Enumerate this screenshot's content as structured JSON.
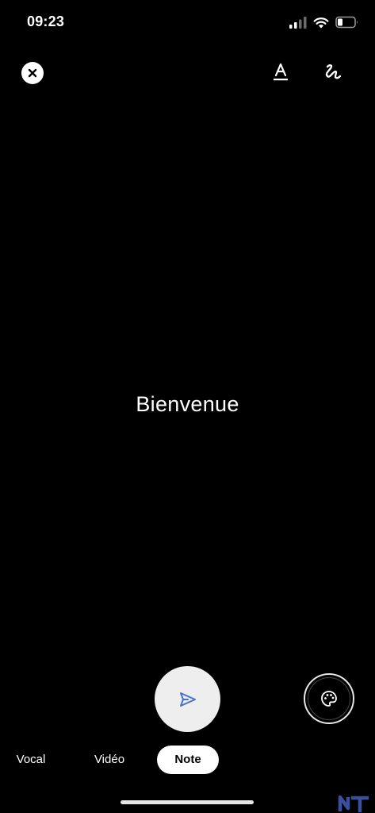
{
  "status_bar": {
    "time": "09:23",
    "icons": [
      "signal-icon",
      "wifi-icon",
      "battery-icon"
    ]
  },
  "toolbar": {
    "close_icon": "close-icon",
    "text_style_icon": "text-style-icon",
    "draw_icon": "squiggle-draw-icon"
  },
  "note": {
    "text": "Bienvenue"
  },
  "actions": {
    "send_icon": "send-icon",
    "palette_icon": "palette-icon"
  },
  "mode_tabs": [
    {
      "label": "Vocal",
      "selected": false
    },
    {
      "label": "Vidéo",
      "selected": false
    },
    {
      "label": "Note",
      "selected": true
    }
  ],
  "colors": {
    "background": "#000000",
    "foreground": "#ffffff",
    "send_icon": "#4a6fd6",
    "send_button_bg": "#eeeeef"
  },
  "watermark": {
    "text": "NT"
  }
}
